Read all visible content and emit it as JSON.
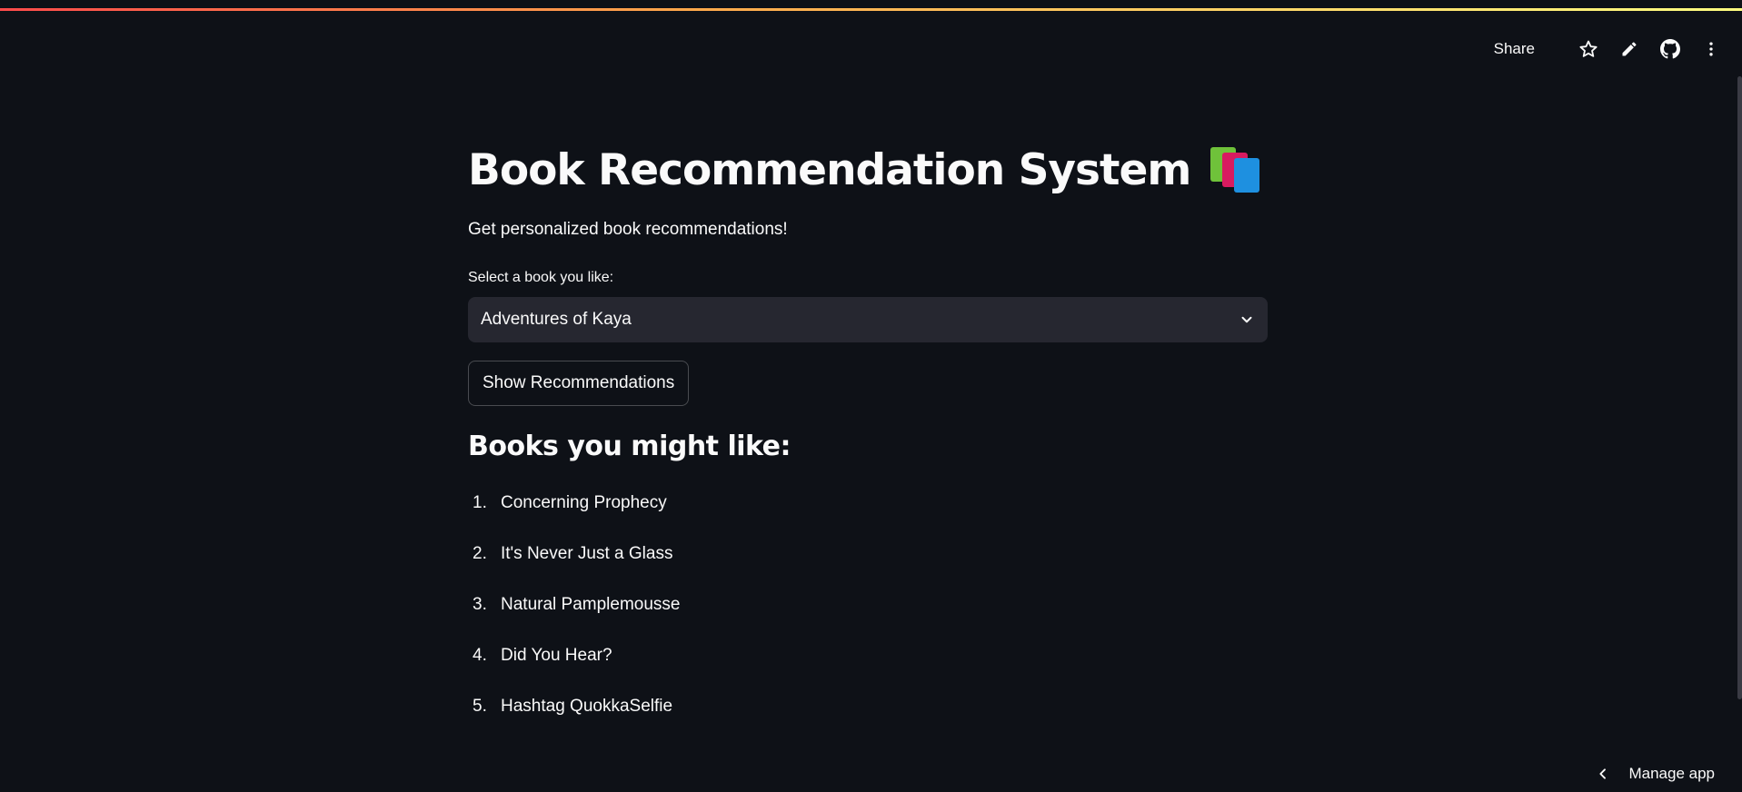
{
  "toolbar": {
    "share_label": "Share",
    "icons": [
      "star-icon",
      "pencil-icon",
      "github-icon",
      "more-vert-icon"
    ]
  },
  "main": {
    "title": "Book Recommendation System",
    "title_emoji": "books-emoji",
    "subtitle": "Get personalized book recommendations!",
    "select": {
      "label": "Select a book you like:",
      "value": "Adventures of Kaya"
    },
    "button_label": "Show Recommendations",
    "recommendations_heading": "Books you might like:",
    "recommendations": [
      {
        "num": "1.",
        "title": "Concerning Prophecy"
      },
      {
        "num": "2.",
        "title": "It's Never Just a Glass"
      },
      {
        "num": "3.",
        "title": "Natural Pamplemousse"
      },
      {
        "num": "4.",
        "title": "Did You Hear?"
      },
      {
        "num": "5.",
        "title": "Hashtag QuokkaSelfie"
      }
    ]
  },
  "footer": {
    "manage_app_label": "Manage app"
  },
  "colors": {
    "background": "#0e1117",
    "text": "#fafafa",
    "select_bg": "#262730",
    "accent_gradient": [
      "#ff4b4b",
      "#ffa94b",
      "#fffd80"
    ]
  }
}
